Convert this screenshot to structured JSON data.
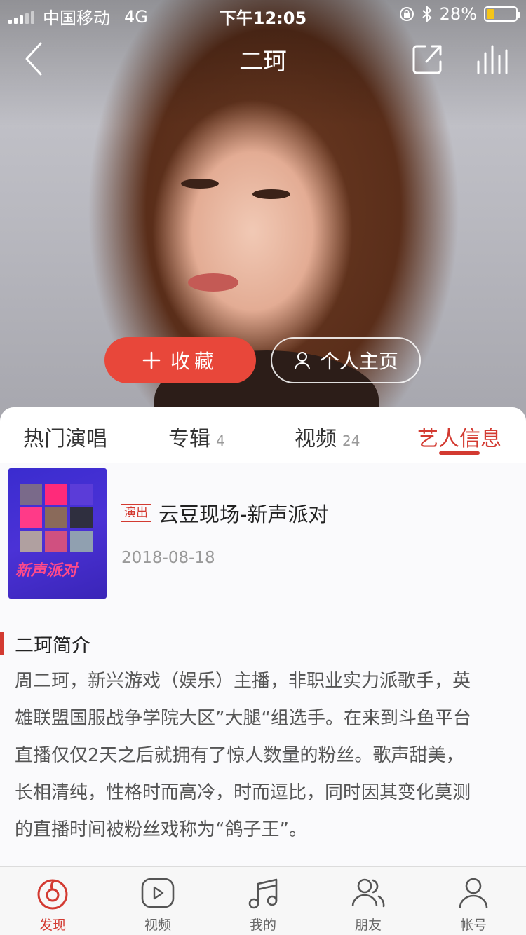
{
  "status_bar": {
    "carrier": "中国移动",
    "network": "4G",
    "time": "下午12:05",
    "battery": "28%",
    "battery_level": 0.28
  },
  "nav": {
    "back_icon": "back-arrow-icon",
    "title": "二珂",
    "share_icon": "share-icon",
    "playing_icon": "now-playing-bars-icon"
  },
  "actions": {
    "favorite_label": "收藏",
    "homepage_label": "个人主页"
  },
  "tabs": [
    {
      "label": "热门演唱",
      "count": ""
    },
    {
      "label": "专辑",
      "count": "4"
    },
    {
      "label": "视频",
      "count": "24"
    },
    {
      "label": "艺人信息",
      "count": ""
    }
  ],
  "active_tab": 3,
  "event": {
    "tag": "演出",
    "title": "云豆现场-新声派对",
    "date": "2018-08-18",
    "poster_text": "新声派对"
  },
  "intro": {
    "title": "二珂简介",
    "lines": [
      "周二珂，新兴游戏（娱乐）主播，非职业实力派歌手，英",
      "雄联盟国服战争学院大区”大腿“组选手。在来到斗鱼平台",
      "直播仅仅2天之后就拥有了惊人数量的粉丝。歌声甜美，",
      "长相清纯，性格时而高冷，时而逗比，同时因其变化莫测",
      "的直播时间被粉丝戏称为“鸽子王”。"
    ]
  },
  "bottom_tabs": [
    {
      "label": "发现",
      "icon": "discover-icon"
    },
    {
      "label": "视频",
      "icon": "video-icon"
    },
    {
      "label": "我的",
      "icon": "music-note-icon"
    },
    {
      "label": "朋友",
      "icon": "friends-icon"
    },
    {
      "label": "帐号",
      "icon": "account-icon"
    }
  ],
  "colors": {
    "accent": "#d33a31",
    "favorite_button": "#e8473a"
  }
}
